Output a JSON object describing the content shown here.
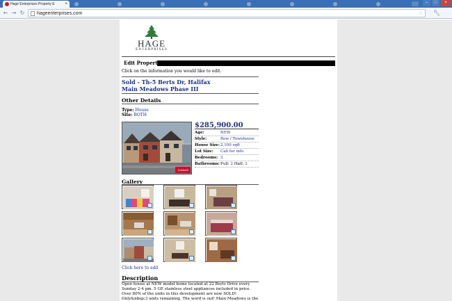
{
  "browser": {
    "active_tab": "Hage Enterprises Property E",
    "other_tabs": [
      "",
      "",
      "",
      "",
      "",
      "",
      "",
      ""
    ],
    "url": "hageenterprises.com"
  },
  "logo": {
    "brand": "HAGE",
    "sub": "ENTERPRISES"
  },
  "edit_label": "Edit Property",
  "intro": "Click on the information you would like to edit.",
  "property": {
    "title_line1": "Sold - Th-5 Berts Dr, Halifax",
    "title_line2": "Main Meadows Phase III"
  },
  "other_details": {
    "heading": "Other Details",
    "type_label": "Type:",
    "type_value": "House",
    "site_label": "Site:",
    "site_value": "BOTH"
  },
  "listing": {
    "price": "$285,900.00",
    "photo_badge": "Coldwell",
    "specs": [
      {
        "k": "Age:",
        "v": "NEW"
      },
      {
        "k": "Style:",
        "v": "Row / Townhouse"
      },
      {
        "k": "House Size:",
        "v": "2,100 sqft"
      },
      {
        "k": "Lot Size:",
        "v": "Call for info"
      },
      {
        "k": "Bedrooms:",
        "v": "3"
      },
      {
        "k": "Bathrooms:",
        "v_full_label": "Full:",
        "v_full": "2",
        "v_half_label": "Half:",
        "v_half": "2"
      }
    ]
  },
  "gallery": {
    "heading": "Gallery",
    "add_link": "Click here to add"
  },
  "description": {
    "heading": "Description",
    "text": "Open house at NEW model home located at 22 Berts Drive every Sunday 2-4 pm. 5 GE stainless steel appliances included in price. Over 80% of the units in this development are now SOLD! Only&nbsp;3 units remaining. The word is out! Main Meadows is the place to be! Final phase now under"
  },
  "colors": {
    "link": "#1a2f8a",
    "tabbar": "#3b6fb5",
    "page_bg": "#e9e9e9"
  },
  "icons": {
    "tab_favicon": "hage-logo-icon",
    "back": "back-arrow-icon",
    "forward": "forward-arrow-icon",
    "reload": "reload-icon",
    "star": "star-icon",
    "wrench": "wrench-icon",
    "gallery_badge": "edit-photo-icon"
  }
}
